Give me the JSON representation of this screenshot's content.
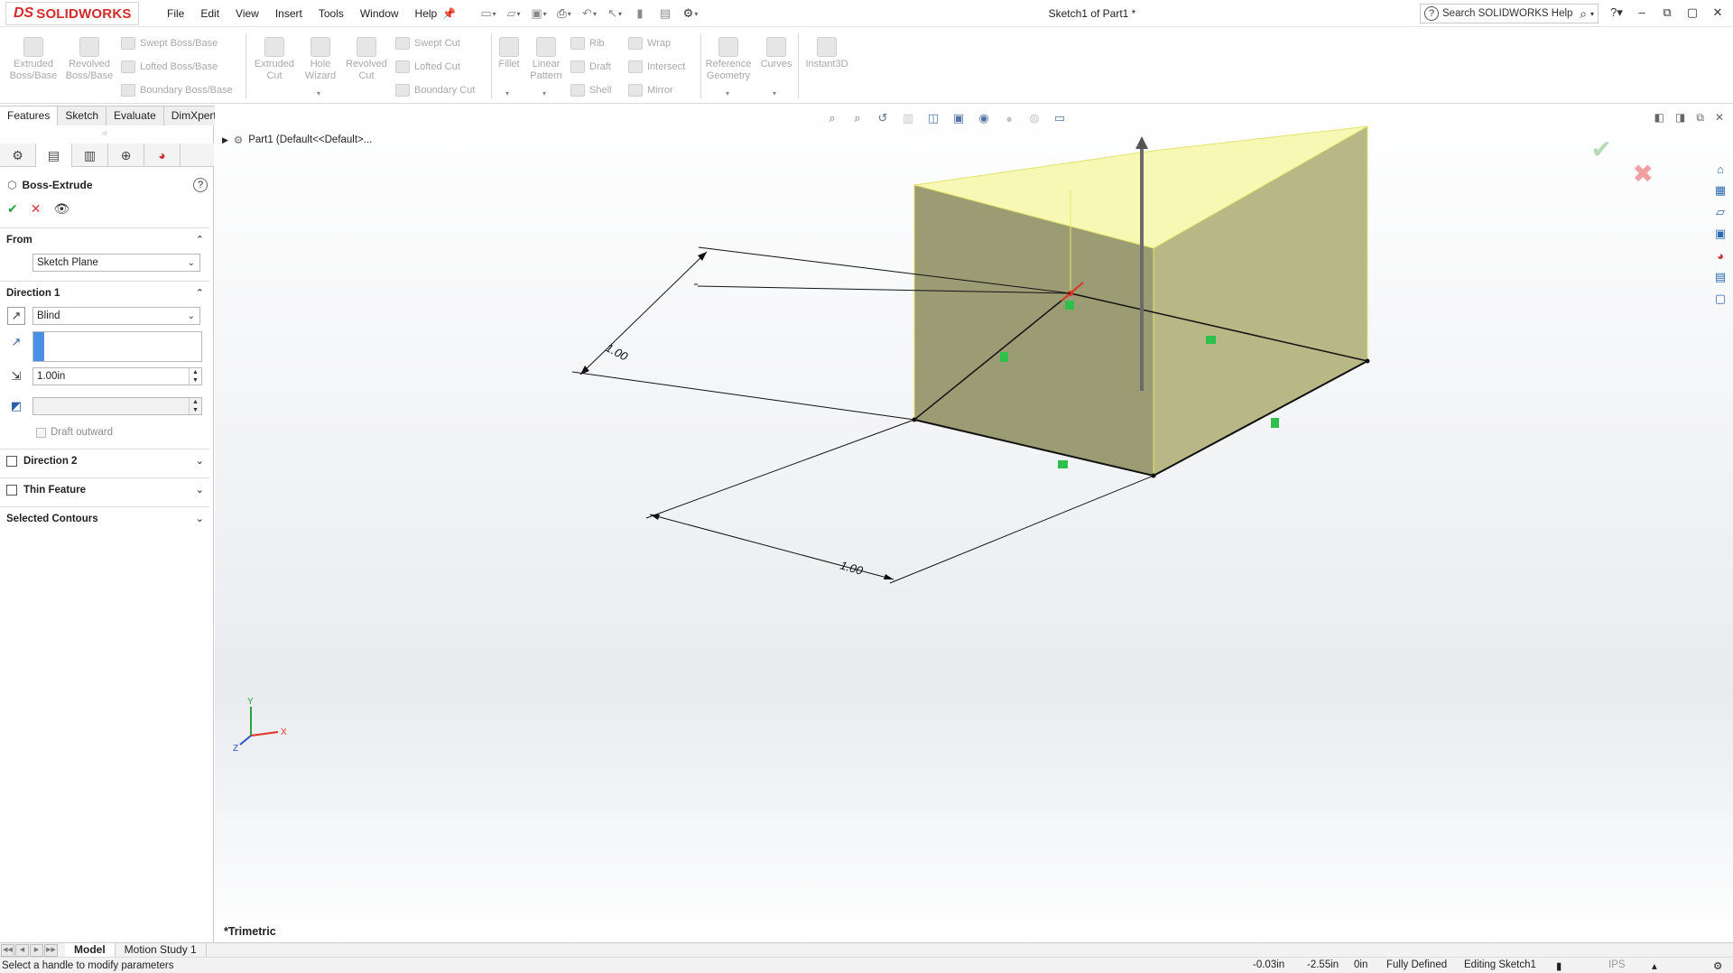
{
  "app": {
    "logo_ds": "DS",
    "logo_text": "SOLIDWORKS",
    "document_title": "Sketch1 of Part1 *",
    "search_placeholder": "Search SOLIDWORKS Help"
  },
  "menu": [
    "File",
    "Edit",
    "View",
    "Insert",
    "Tools",
    "Window",
    "Help"
  ],
  "quick_access_icons": [
    "new-icon",
    "open-icon",
    "save-icon",
    "print-icon",
    "undo-icon",
    "select-icon",
    "rebuild-icon",
    "file-properties-icon",
    "options-icon"
  ],
  "command_manager": {
    "extruded_boss": [
      "Extruded",
      "Boss/Base"
    ],
    "revolved_boss": [
      "Revolved",
      "Boss/Base"
    ],
    "swept_boss": "Swept Boss/Base",
    "lofted_boss": "Lofted Boss/Base",
    "boundary_boss": "Boundary Boss/Base",
    "extruded_cut": [
      "Extruded",
      "Cut"
    ],
    "hole_wizard": [
      "Hole",
      "Wizard"
    ],
    "revolved_cut": [
      "Revolved",
      "Cut"
    ],
    "swept_cut": "Swept Cut",
    "lofted_cut": "Lofted Cut",
    "boundary_cut": "Boundary Cut",
    "fillet": "Fillet",
    "linear_pattern": [
      "Linear",
      "Pattern"
    ],
    "rib": "Rib",
    "draft": "Draft",
    "shell": "Shell",
    "wrap": "Wrap",
    "intersect": "Intersect",
    "mirror": "Mirror",
    "reference_geometry": [
      "Reference",
      "Geometry"
    ],
    "curves": "Curves",
    "instant3d": "Instant3D"
  },
  "tabs": [
    "Features",
    "Sketch",
    "Evaluate",
    "DimXpert"
  ],
  "property_manager": {
    "title": "Boss-Extrude",
    "from_label": "From",
    "from_value": "Sketch Plane",
    "direction1_label": "Direction 1",
    "end_condition": "Blind",
    "depth_value": "1.00in",
    "draft_outward_label": "Draft outward",
    "direction2_label": "Direction 2",
    "thin_feature_label": "Thin Feature",
    "selected_contours_label": "Selected Contours"
  },
  "feature_tree": {
    "part_label": "Part1  (Default<<Default>..."
  },
  "graphics": {
    "view_orientation": "*Trimetric",
    "dimension_1": "1.00",
    "dimension_2": "1.00",
    "triad_x": "X",
    "triad_y": "Y",
    "triad_z": "Z"
  },
  "bottom_tabs": [
    "Model",
    "Motion Study 1"
  ],
  "status": {
    "message": "Select a handle to modify parameters",
    "x": "-0.03in",
    "y": "-2.55in",
    "z": "0in",
    "state": "Fully Defined",
    "editing": "Editing Sketch1",
    "units": "IPS"
  },
  "colors": {
    "brand_red": "#d42a2a",
    "preview_yellow": "#f5f5a0",
    "accept_green": "#2ea043",
    "cancel_red": "#d93636"
  }
}
